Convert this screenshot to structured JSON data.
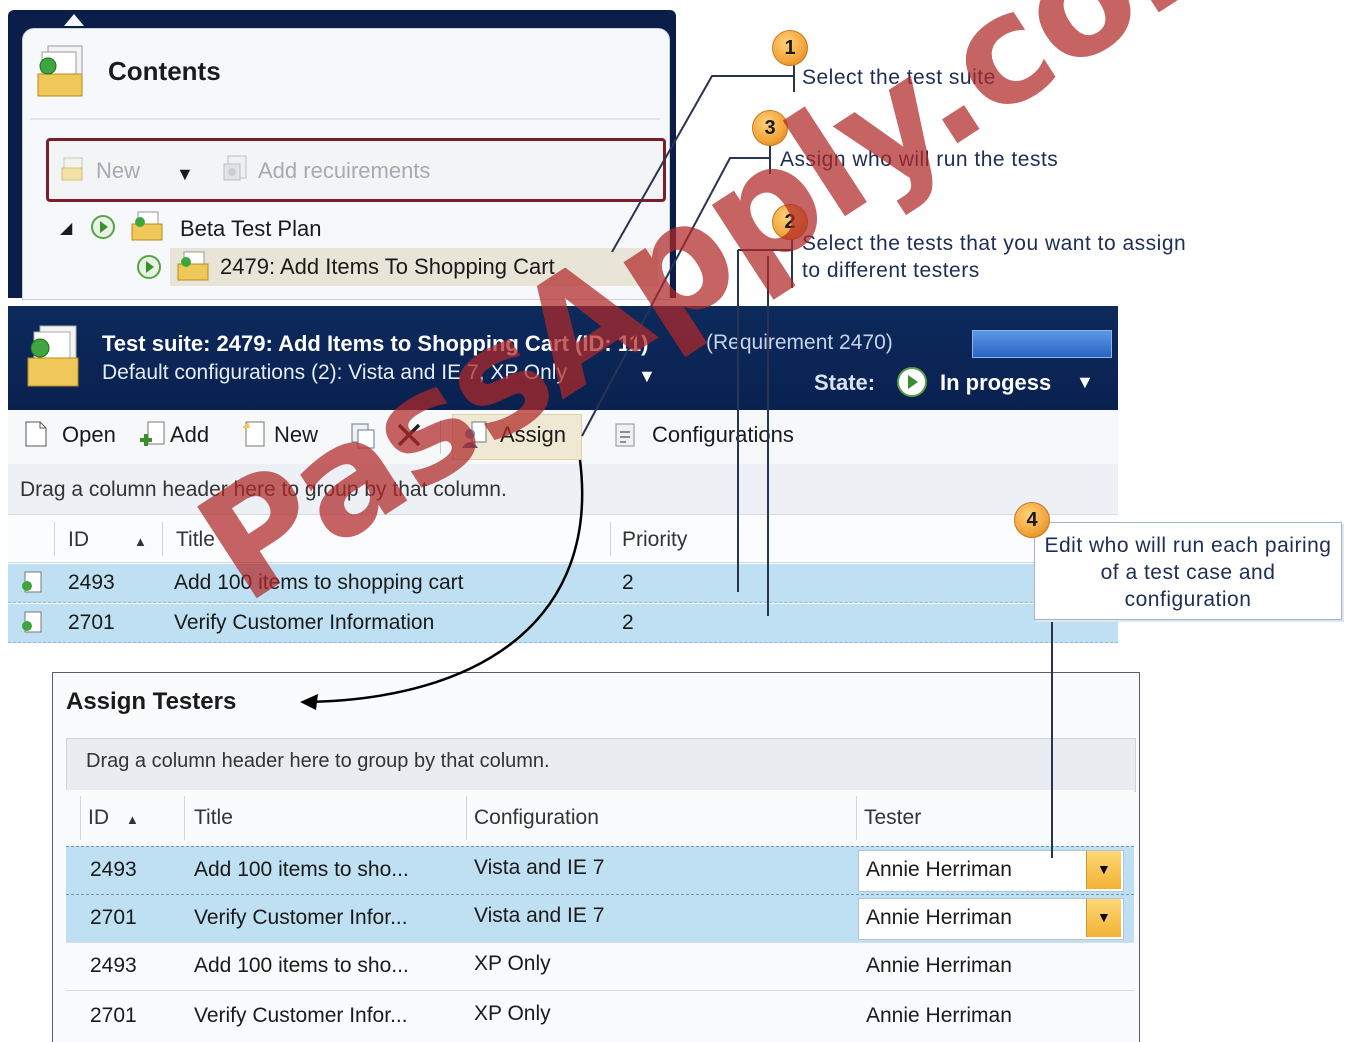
{
  "contents": {
    "title": "Contents",
    "toolbar": {
      "new_label": "New",
      "add_requirements_label": "Add recuirements"
    },
    "tree": {
      "plan_label": "Beta Test Plan",
      "suite_label": "2479: Add Items To Shopping Cart"
    }
  },
  "suite": {
    "title": "Test suite:  2479: Add Items to Shopping Cart (ID: 11)",
    "requirement": "(Requirement 2470)",
    "configurations": "Default configurations (2): Vista and IE 7, XP Only",
    "state_label": "State:",
    "state_value": "In progess",
    "toolbar": {
      "open": "Open",
      "add": "Add",
      "new": "New",
      "assign": "Assign",
      "configurations": "Configurations"
    },
    "group_hint": "Drag a column header here to group by that column.",
    "columns": {
      "id": "ID",
      "title": "Title",
      "priority": "Priority"
    },
    "rows": [
      {
        "id": "2493",
        "title": "Add 100 items to shopping cart",
        "priority": "2"
      },
      {
        "id": "2701",
        "title": "Verify Customer Information",
        "priority": "2"
      }
    ]
  },
  "assign": {
    "title": "Assign Testers",
    "group_hint": "Drag a column header here to group by that column.",
    "columns": {
      "id": "ID",
      "title": "Title",
      "configuration": "Configuration",
      "tester": "Tester"
    },
    "rows": [
      {
        "id": "2493",
        "title": "Add 100 items to sho...",
        "configuration": "Vista and IE 7",
        "tester": "Annie Herriman"
      },
      {
        "id": "2701",
        "title": "Verify Customer Infor...",
        "configuration": "Vista and IE 7",
        "tester": "Annie Herriman"
      },
      {
        "id": "2493",
        "title": "Add 100 items to sho...",
        "configuration": "XP Only",
        "tester": "Annie Herriman"
      },
      {
        "id": "2701",
        "title": "Verify Customer Infor...",
        "configuration": "XP Only",
        "tester": "Annie Herriman"
      }
    ]
  },
  "callouts": [
    {
      "number": "1",
      "text": "Select the test suite"
    },
    {
      "number": "3",
      "text": "Assign who will run the tests"
    },
    {
      "number": "2",
      "text": "Select the tests that you want to assign to different testers"
    },
    {
      "number": "4",
      "text": "Edit who will run each pairing of a test case and configuration"
    }
  ],
  "watermark": "PassApply.com",
  "colors": {
    "header_navy": "#0a2150",
    "selection_blue": "#bfe0f2",
    "callout_orange": "#f2a43a",
    "watermark_red": "#b02828"
  },
  "icons": [
    "contents-icon",
    "play-icon",
    "test-plan-icon",
    "test-suite-icon",
    "open-icon",
    "add-icon",
    "new-icon",
    "copy-icon",
    "delete-icon",
    "assign-icon",
    "configurations-icon",
    "test-case-icon",
    "dropdown-arrow-icon"
  ]
}
